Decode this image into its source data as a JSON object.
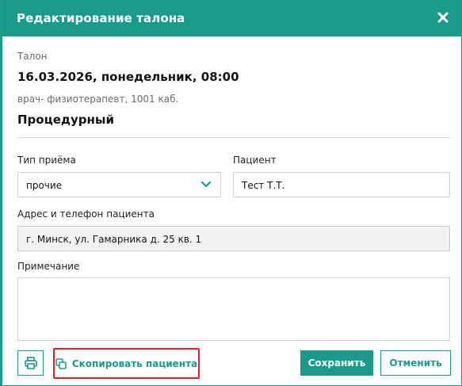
{
  "dialog": {
    "title": "Редактирование талона",
    "close_icon": "close-icon"
  },
  "ticket": {
    "section_label": "Талон",
    "datetime": "16.03.2026, понедельник, 08:00",
    "doctor": "врач- физиотерапевт, 1001 каб.",
    "room": "Процедурный"
  },
  "form": {
    "visit_type_label": "Тип приёма",
    "visit_type_value": "прочие",
    "patient_label": "Пациент",
    "patient_value": "Тест Т.Т.",
    "address_label": "Адрес и телефон пациента",
    "address_value": "г. Минск, ул. Гамарника д. 25 кв. 1",
    "note_label": "Примечание",
    "note_value": ""
  },
  "footer": {
    "print_icon": "printer-icon",
    "copy_icon": "copy-icon",
    "copy_label": "Скопировать пациента",
    "save_label": "Сохранить",
    "cancel_label": "Отменить"
  },
  "colors": {
    "accent": "#1a9a8b",
    "highlight": "#e0202a"
  }
}
